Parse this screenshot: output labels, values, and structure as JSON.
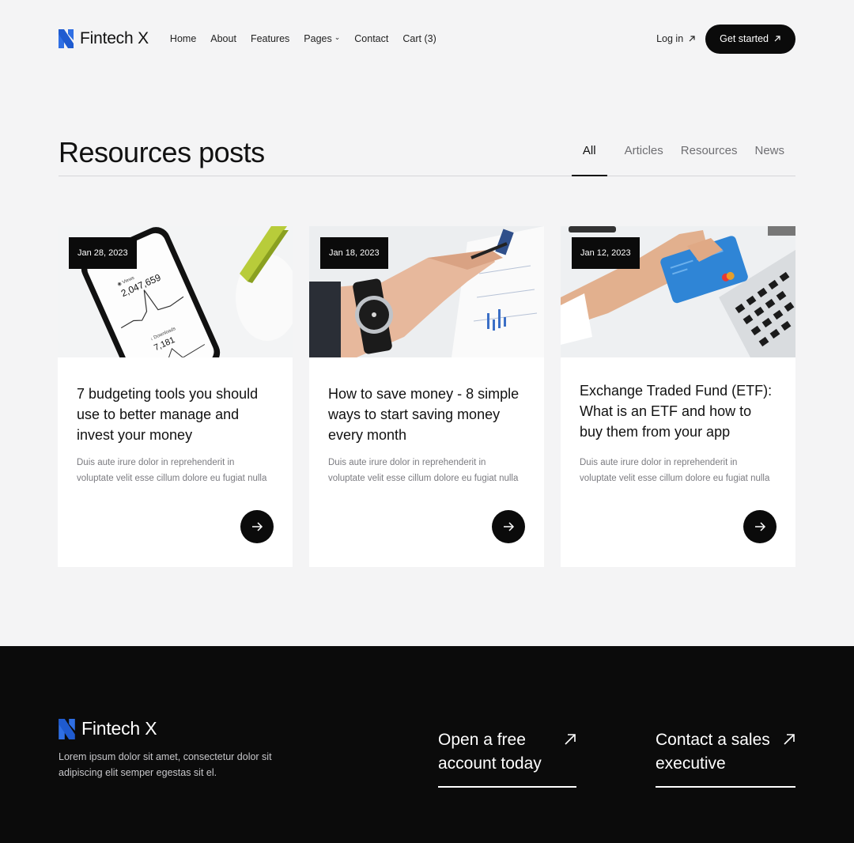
{
  "brand": {
    "name": "Fintech X",
    "accent": "#2f6fe4"
  },
  "nav": {
    "items": [
      "Home",
      "About",
      "Features",
      "Pages",
      "Contact",
      "Cart (3)"
    ],
    "login": "Log in",
    "cta": "Get started"
  },
  "header": {
    "title": "Resources posts",
    "tabs": [
      "All",
      "Articles",
      "Resources",
      "News"
    ],
    "active_tab": "All"
  },
  "posts": [
    {
      "date": "Jan 28, 2023",
      "title": "7 budgeting tools you should use to better manage and invest your money",
      "excerpt": "Duis aute irure dolor in reprehenderit in voluptate velit esse cillum dolore eu fugiat nulla",
      "image": "phone-analytics-image",
      "phone_stats": {
        "views": "2,047,659",
        "downloads": "7,181"
      }
    },
    {
      "date": "Jan 18, 2023",
      "title": "How to save money - 8 simple ways to start saving money every month",
      "excerpt": "Duis aute irure dolor in reprehenderit in voluptate velit esse cillum dolore eu fugiat nulla",
      "image": "hand-writing-watch-image"
    },
    {
      "date": "Jan 12, 2023",
      "title": "Exchange Traded Fund (ETF): What is an ETF and how to buy them from your app",
      "excerpt": "Duis aute irure dolor in reprehenderit in voluptate velit esse cillum dolore eu fugiat nulla",
      "image": "credit-card-laptop-image"
    }
  ],
  "footer": {
    "brand": "Fintech X",
    "description": "Lorem ipsum dolor sit amet, consectetur dolor sit adipiscing elit semper egestas sit el.",
    "cta_primary": "Open a free account today",
    "cta_secondary": "Contact a sales executive"
  }
}
